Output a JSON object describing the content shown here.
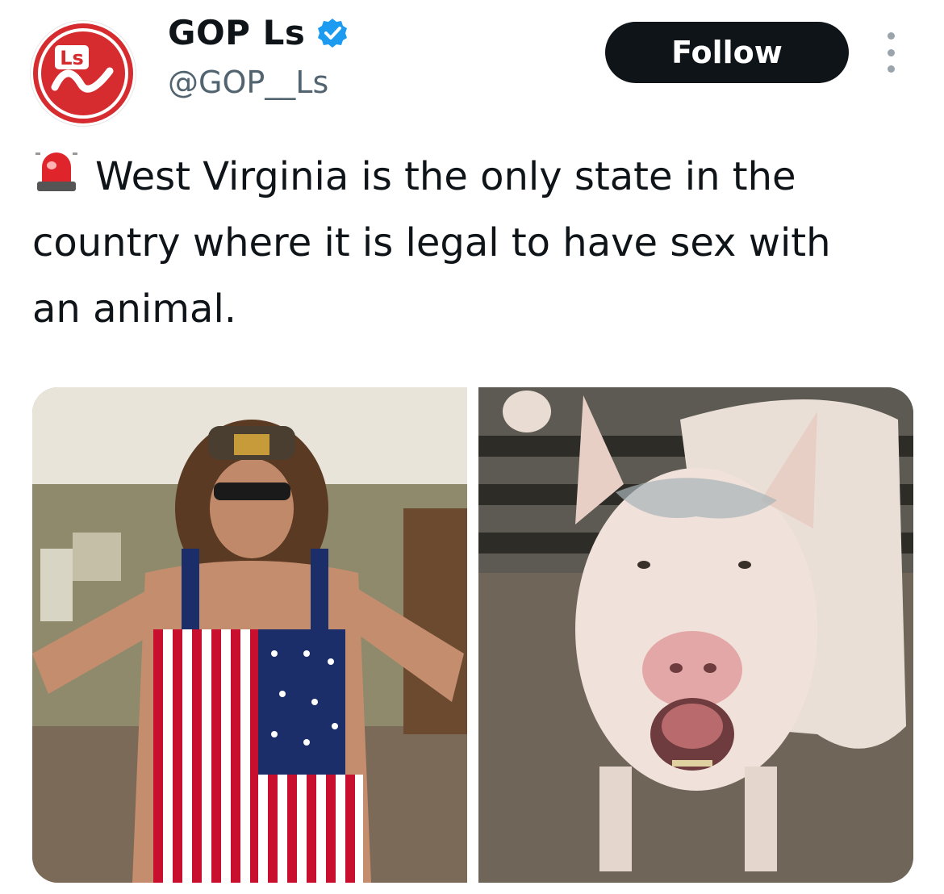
{
  "tweet": {
    "author": {
      "display_name": "GOP Ls",
      "handle": "@GOP__Ls",
      "verified": true,
      "avatar_logo_text": "Ls",
      "avatar_color": "#d62b2f",
      "verified_color": "#1d9bf0"
    },
    "follow_label": "Follow",
    "siren_emoji": "🚨",
    "text": "West Virginia is the only state in the country where it is legal to have sex with an animal.",
    "media": [
      {
        "description_icon": "man-in-flag-overalls-photo"
      },
      {
        "description_icon": "pig-photo"
      }
    ]
  }
}
